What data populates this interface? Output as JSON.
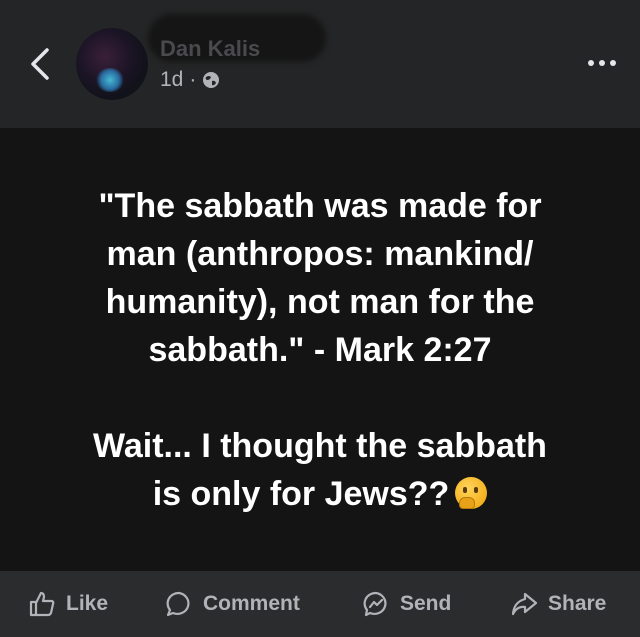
{
  "header": {
    "author_name": "Dan Kalis",
    "time": "1d",
    "separator": "·"
  },
  "post": {
    "lines": [
      "\"The sabbath was made for",
      "man (anthropos: mankind/",
      "humanity), not man for the",
      "sabbath.\" - Mark 2:27"
    ],
    "lines2": [
      "Wait... I thought the sabbath",
      "is only for Jews??"
    ],
    "emoji": "thinking-face"
  },
  "actions": {
    "like": "Like",
    "comment": "Comment",
    "send": "Send",
    "share": "Share"
  },
  "icons": {
    "back": "back-chevron-icon",
    "privacy": "globe-icon",
    "more": "more-dots-icon"
  }
}
